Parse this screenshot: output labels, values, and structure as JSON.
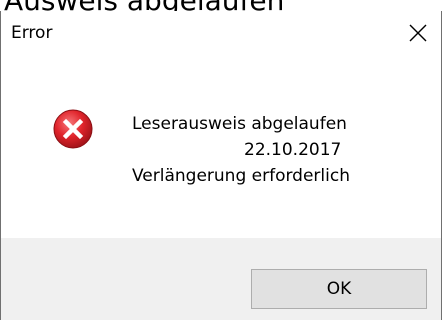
{
  "background": {
    "title_fragment": "Ausweis abgelaufen"
  },
  "dialog": {
    "title": "Error",
    "close_icon": "close-icon",
    "message": {
      "line1": "Leserausweis abgelaufen",
      "line2": "22.10.2017",
      "line3": "Verlängerung erforderlich"
    },
    "icon": "error-icon",
    "ok_label": "OK"
  },
  "colors": {
    "error_red": "#e81123",
    "button_bg": "#e1e1e1",
    "footer_bg": "#f0f0f0"
  }
}
